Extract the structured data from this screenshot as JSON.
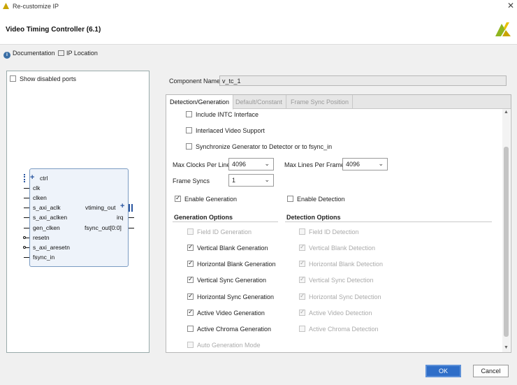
{
  "window": {
    "title": "Re-customize IP"
  },
  "header": {
    "title": "Video Timing Controller (6.1)"
  },
  "links": {
    "documentation": "Documentation",
    "ip_location": "IP Location"
  },
  "left": {
    "show_disabled_ports": "Show disabled ports",
    "block": {
      "left_ports": [
        "ctrl",
        "clk",
        "clken",
        "s_axi_aclk",
        "s_axi_aclken",
        "gen_clken",
        "resetn",
        "s_axi_aresetn",
        "fsync_in"
      ],
      "right_ports": [
        "vtiming_out",
        "irq",
        "fsync_out[0:0]"
      ]
    }
  },
  "component": {
    "label": "Component Name",
    "value": "v_tc_1"
  },
  "tabs": [
    "Detection/Generation",
    "Default/Constant",
    "Frame Sync Position"
  ],
  "options": {
    "include_intc": "Include INTC Interface",
    "interlaced": "Interlaced Video Support",
    "synchronize": "Synchronize Generator to Detector or to fsync_in"
  },
  "fields": {
    "max_clocks_label": "Max Clocks Per Line",
    "max_clocks_value": "4096",
    "max_lines_label": "Max Lines Per Frame",
    "max_lines_value": "4096",
    "frame_syncs_label": "Frame Syncs",
    "frame_syncs_value": "1"
  },
  "enable": {
    "generation": "Enable Generation",
    "detection": "Enable Detection"
  },
  "generation": {
    "title": "Generation Options",
    "items": [
      "Field ID Generation",
      "Vertical Blank Generation",
      "Horizontal Blank Generation",
      "Vertical Sync Generation",
      "Horizontal Sync Generation",
      "Active Video Generation",
      "Active Chroma Generation",
      "Auto Generation Mode"
    ]
  },
  "detection": {
    "title": "Detection Options",
    "items": [
      "Field ID Detection",
      "Vertical Blank Detection",
      "Horizontal Blank Detection",
      "Vertical Sync Detection",
      "Horizontal Sync Detection",
      "Active Video Detection",
      "Active Chroma Detection"
    ]
  },
  "buttons": {
    "ok": "OK",
    "cancel": "Cancel"
  },
  "colors": {
    "accent": "#2f6ec8",
    "logo": "#c9a400"
  }
}
